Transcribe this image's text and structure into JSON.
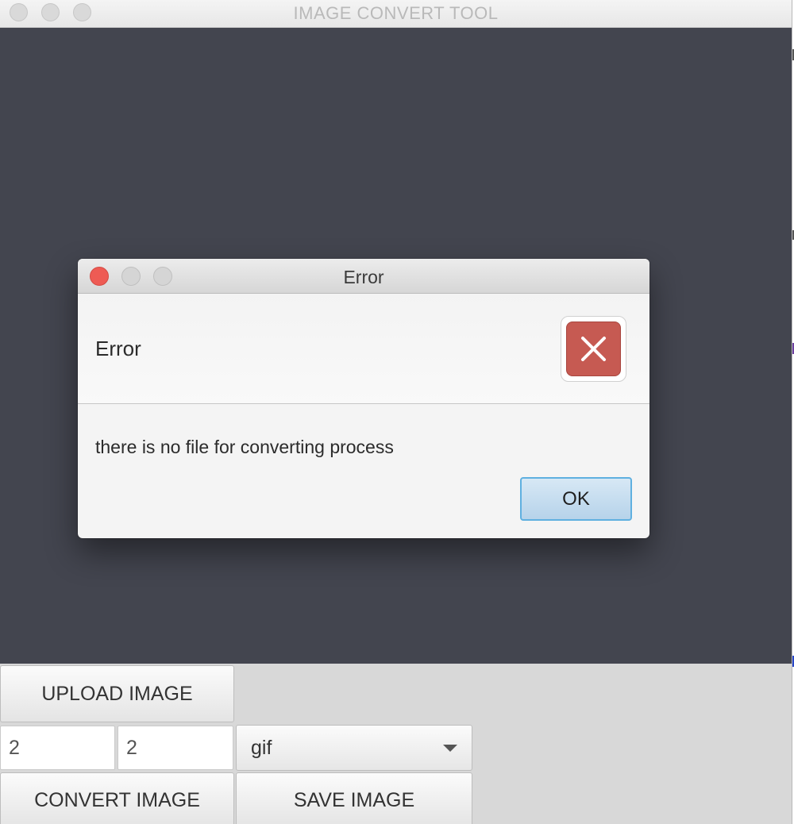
{
  "app": {
    "title": "IMAGE CONVERT TOOL"
  },
  "controls": {
    "upload_label": "UPLOAD IMAGE",
    "width_value": "2",
    "height_value": "2",
    "format_selected": "gif",
    "convert_label": "CONVERT IMAGE",
    "save_label": "SAVE IMAGE"
  },
  "dialog": {
    "title": "Error",
    "header": "Error",
    "message": "there is no file for converting process",
    "ok_label": "OK",
    "icon": "error-x-icon"
  },
  "colors": {
    "canvas_bg": "#43454f",
    "error_red": "#c65a52",
    "close_red": "#ee5b54",
    "ok_focus": "#5fb0e0"
  }
}
